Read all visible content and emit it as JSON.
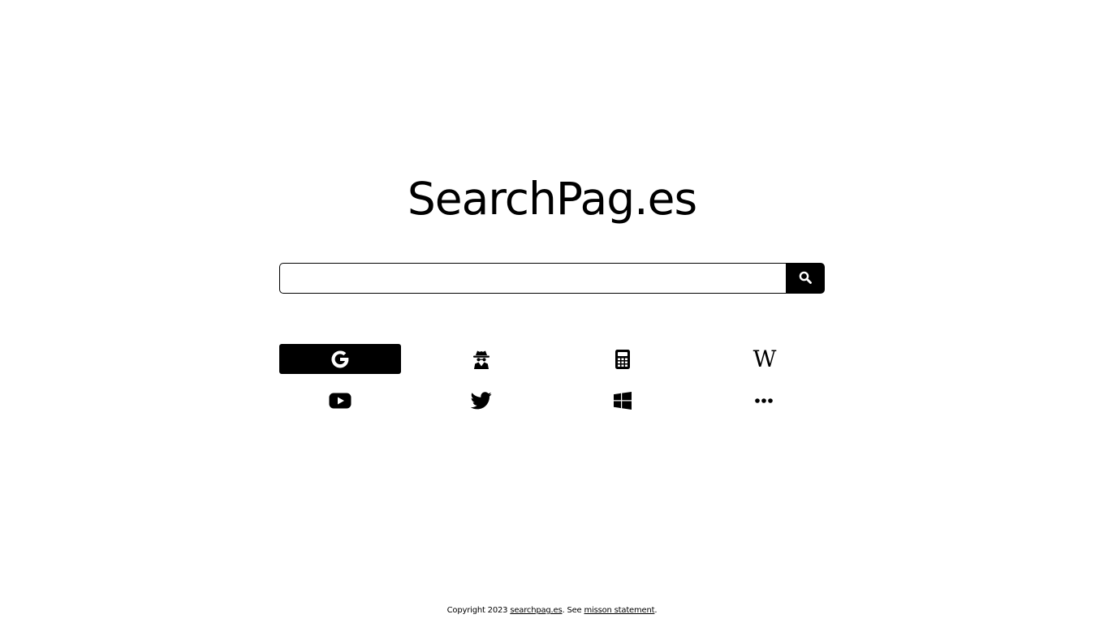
{
  "title": "SearchPag.es",
  "search": {
    "value": "",
    "placeholder": "",
    "button_icon": "search-icon"
  },
  "engines": [
    {
      "name": "Google",
      "icon": "google-icon",
      "selected": true
    },
    {
      "name": "Private search",
      "icon": "spy-icon",
      "selected": false
    },
    {
      "name": "Calculator",
      "icon": "calculator-icon",
      "selected": false
    },
    {
      "name": "Wikipedia",
      "icon": "wikipedia-icon",
      "label": "W",
      "selected": false
    },
    {
      "name": "YouTube",
      "icon": "youtube-icon",
      "selected": false
    },
    {
      "name": "Twitter",
      "icon": "twitter-icon",
      "selected": false
    },
    {
      "name": "Windows",
      "icon": "windows-icon",
      "selected": false
    },
    {
      "name": "More",
      "icon": "more-icon",
      "selected": false
    }
  ],
  "footer": {
    "prefix": "Copyright 2023 ",
    "site_link": "searchpag.es",
    "middle": ". See ",
    "mission_link": "misson statement",
    "suffix": "."
  },
  "colors": {
    "background": "#ffffff",
    "foreground": "#000000",
    "selected_background": "#000000",
    "selected_foreground": "#ffffff"
  }
}
